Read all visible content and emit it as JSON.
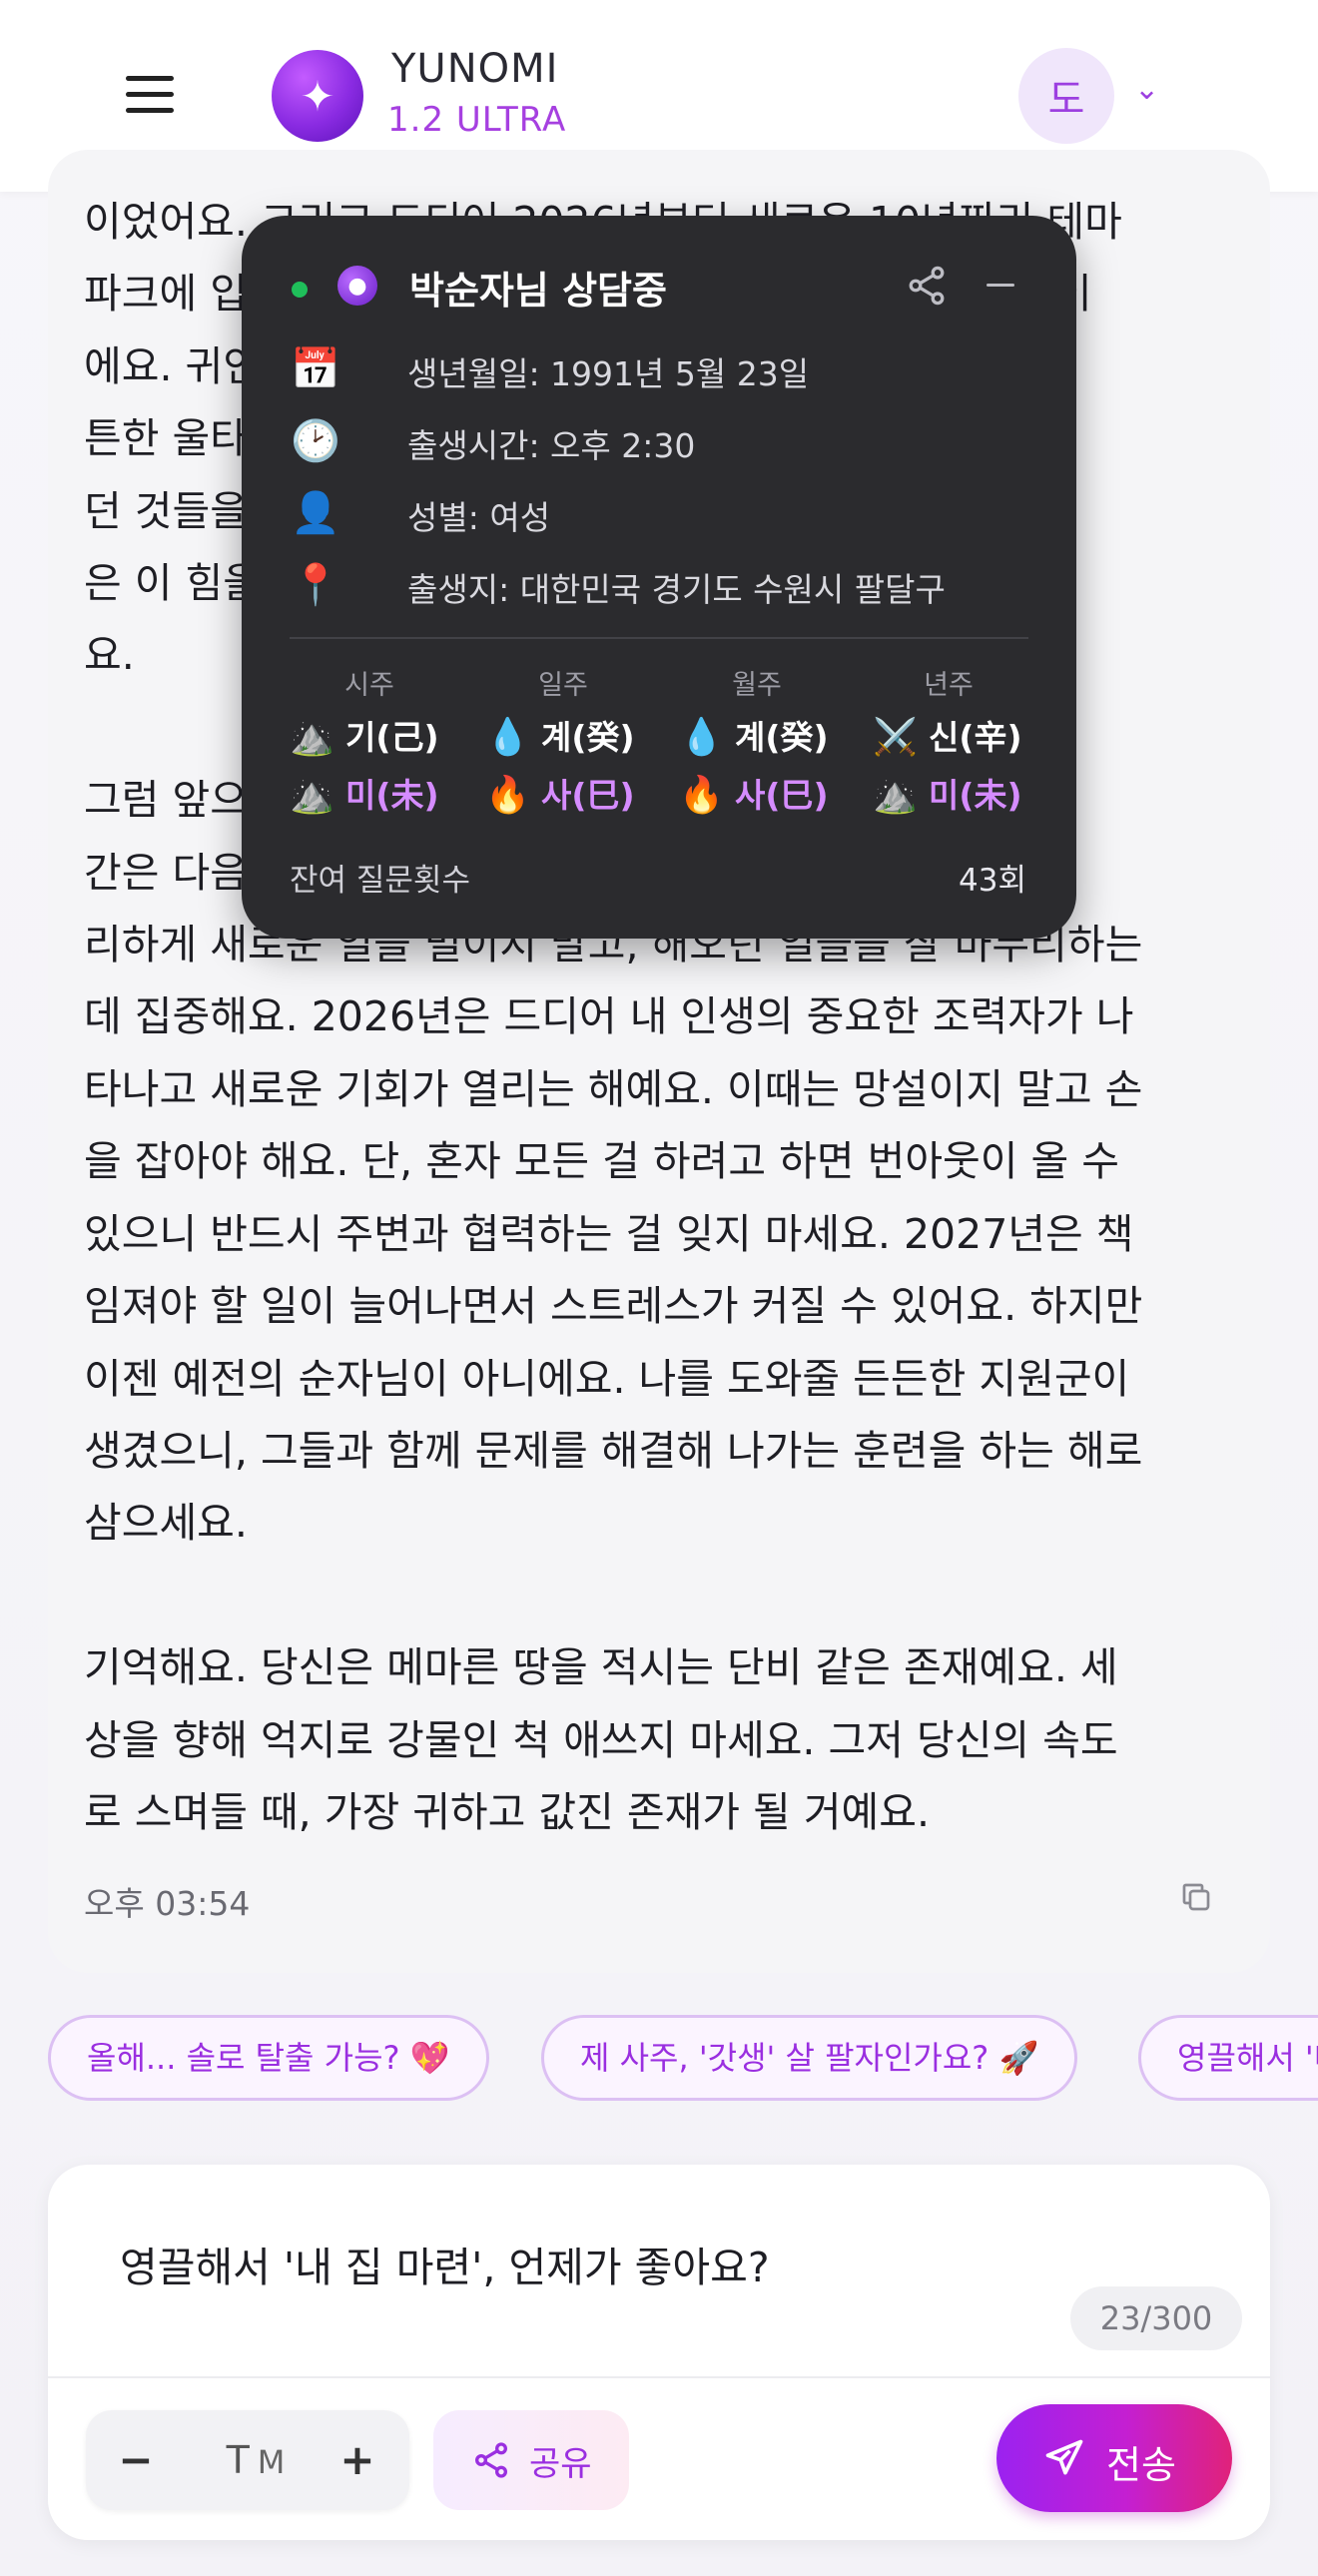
{
  "header": {
    "brand_name": "YUNOMI",
    "brand_sub": "1.2 ULTRA",
    "avatar_initial": "도"
  },
  "message": {
    "text": "이었어요. 그리고 드디어 2026년부터 새로운 10년짜리 테마\n파크에 입장하게 돼요. 당신이 주인공이 되는 새로운 시즌이\n에요. 귀인의 도움이 찾아오고 당신을 보호해 주는 튼\n튼한 울타리가 생기면서, 그동안 혼자 고민하며 꿈꿔왔\n던 것들을 하나씩 이루어 나갈 수 있게 돼요. 다음 10년\n은 이 힘을 바탕으로 당신의 세상을 넓혀가게 될 거고\n요.\n\n그럼 앞으로의 3년은 어떻게 보내야 할까요? 순자님은 기\n간은 다음 단계로 넘어가기 위한 준비 시간이에요. 무\n리하게 새로운 일을 벌이지 말고, 해오던 일들을 잘 마무리하는\n데 집중해요. 2026년은 드디어 내 인생의 중요한 조력자가 나\n타나고 새로운 기회가 열리는 해예요. 이때는 망설이지 말고 손\n을 잡아야 해요. 단, 혼자 모든 걸 하려고 하면 번아웃이 올 수\n있으니 반드시 주변과 협력하는 걸 잊지 마세요. 2027년은 책\n임져야 할 일이 늘어나면서 스트레스가 커질 수 있어요. 하지만\n이젠 예전의 순자님이 아니에요. 나를 도와줄 든든한 지원군이\n생겼으니, 그들과 함께 문제를 해결해 나가는 훈련을 하는 해로\n삼으세요.\n\n기억해요. 당신은 메마른 땅을 적시는 단비 같은 존재예요. 세\n상을 향해 억지로 강물인 척 애쓰지 마세요. 그저 당신의 속도\n로 스며들 때, 가장 귀하고 값진 존재가 될 거예요.",
    "time": "오후 03:54"
  },
  "panel": {
    "title": "박순자님 상담중",
    "info": [
      {
        "icon": "calendar-icon",
        "glyph": "📅",
        "text": "생년월일: 1991년 5월 23일"
      },
      {
        "icon": "clock-icon",
        "glyph": "🕑",
        "text": "출생시간: 오후 2:30"
      },
      {
        "icon": "person-icon",
        "glyph": "👤",
        "text": "성별: 여성"
      },
      {
        "icon": "pin-icon",
        "glyph": "📍",
        "text": "출생지: 대한민국 경기도 수원시 팔달구"
      }
    ],
    "pillars": [
      {
        "head": "시주",
        "stem": "기(己)",
        "stem_glyph": "⛰️",
        "branch": "미(未)",
        "branch_glyph": "⛰️"
      },
      {
        "head": "일주",
        "stem": "계(癸)",
        "stem_glyph": "💧",
        "branch": "사(巳)",
        "branch_glyph": "🔥"
      },
      {
        "head": "월주",
        "stem": "계(癸)",
        "stem_glyph": "💧",
        "branch": "사(巳)",
        "branch_glyph": "🔥"
      },
      {
        "head": "년주",
        "stem": "신(辛)",
        "stem_glyph": "⚔️",
        "branch": "미(未)",
        "branch_glyph": "⛰️"
      }
    ],
    "remain_label": "잔여 질문횟수",
    "remain_count": "43회"
  },
  "chips": [
    "올해... 솔로 탈출 가능? 💖",
    "제 사주, '갓생' 살 팔자인가요? 🚀",
    "영끌해서 '내 집 마련', 언제가 좋아요?"
  ],
  "composer": {
    "value": "영끌해서 '내 집 마련', 언제가 좋아요?",
    "char_count": "23/300",
    "font_size_label": "M",
    "font_minus": "−",
    "font_plus": "+",
    "share_label": "공유",
    "send_label": "전송"
  },
  "colors": {
    "accent": "#9a2fe0",
    "send_gradient_end": "#e0227a",
    "panel_bg": "#2b2b2e",
    "status_online": "#1fbf5a"
  }
}
